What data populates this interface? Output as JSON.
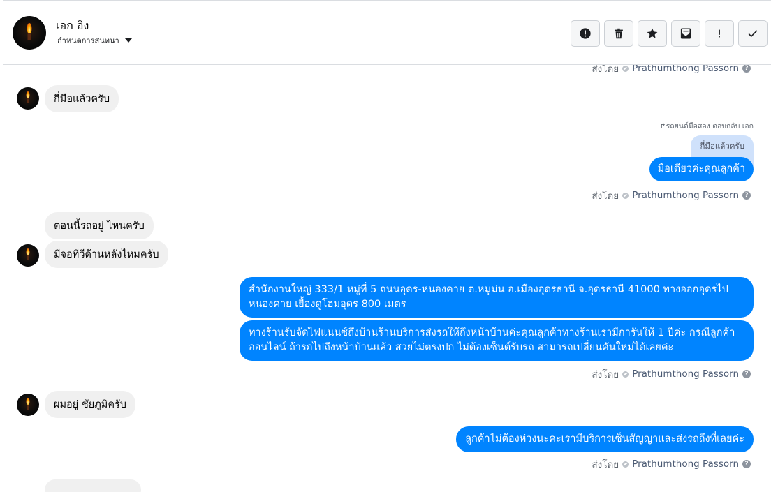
{
  "header": {
    "contact_name": "เอก อิง",
    "assign_label": "กำหนดการสนทนา"
  },
  "toolbar": {
    "buttons": [
      {
        "name": "report-spam-button",
        "icon": "alert-circle-icon"
      },
      {
        "name": "delete-button",
        "icon": "trash-icon"
      },
      {
        "name": "star-button",
        "icon": "star-icon"
      },
      {
        "name": "mark-unread-button",
        "icon": "envelope-icon"
      },
      {
        "name": "follow-up-button",
        "icon": "exclamation-icon"
      },
      {
        "name": "mark-done-button",
        "icon": "check-icon"
      }
    ]
  },
  "sent_by": {
    "label": "ส่งโดย",
    "author": "Prathumthong Passorn",
    "help": "?"
  },
  "messages": {
    "m1": "กี่มือแล้วครับ",
    "reply_note": "↱รถยนต์มือสอง ตอบกลับ เอก",
    "reply_quote": "กี่มือแล้วครับ",
    "m2": "มือเดียวค่ะคุณลูกค้า",
    "m3": "ตอนนี้รถอยู่ ไหนครับ",
    "m4": "มีจอทีวีด้านหลังไหมครับ",
    "m5": "สำนักงานใหญ่ 333/1 หมู่ที่ 5 ถนนอุดร-หนองคาย ต.หมูม่น อ.เมืองอุดรธานี จ.อุดรธานี 41000 ทางออกอุดรไป หนองคาย เยื้องดูโฮมอุดร 800 เมตร",
    "m6": "ทางร้านรับจัดไฟแนนซ์ถึงบ้านร้านบริการส่งรถให้ถึงหน้าบ้านค่ะคุณลูกค้าทางร้านเรามีการันให้ 1 ปีค่ะ กรณีลูกค้า ออนไลน์ ถ้ารถไปถึงหน้าบ้านแล้ว สวยไม่ตรงปก ไม่ต้องเซ็นต์รับรถ สามารถเปลี่ยนคันใหม่ได้เลยค่ะ",
    "m7": "ผมอยู่ ชัยภูมิครับ",
    "m8": "ลูกค้าไม่ต้องห่วงนะคะเรามีบริการเซ็นสัญญาและส่งรถถึงที่เลยค่ะ"
  },
  "colors": {
    "outgoing_bubble": "#0084ff",
    "incoming_bubble": "#f0f0f0",
    "reply_quote": "#cfe1fb"
  }
}
